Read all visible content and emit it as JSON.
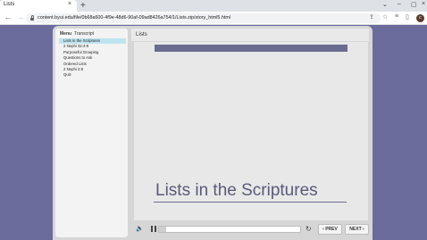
{
  "browser": {
    "tab_title": "Lists",
    "tab_close": "×",
    "new_tab": "+",
    "url": "content.byui.edu/file/0b68a600-4f9e-48d6-90af-09ad8426a754/1/Lists.zip/story_html5.html",
    "window_controls": {
      "menu": "⌄",
      "minimize": "–",
      "maximize": "▢",
      "close": "×"
    },
    "nav": {
      "back": "←",
      "forward": "→",
      "reload": "↻"
    },
    "profile_initial": "c"
  },
  "player": {
    "sidebar": {
      "tabs": [
        {
          "label": "Menu",
          "active": true
        },
        {
          "label": "Transcript",
          "active": false
        }
      ],
      "items": [
        {
          "label": "Lists in the Scriptures",
          "selected": true
        },
        {
          "label": "2 Nephi 32:4-9",
          "selected": false
        },
        {
          "label": "Purposeful Grouping",
          "selected": false
        },
        {
          "label": "Questions to Ask",
          "selected": false
        },
        {
          "label": "Ordered Lists",
          "selected": false
        },
        {
          "label": "2 Nephi 2:8",
          "selected": false
        },
        {
          "label": "Quiz",
          "selected": false
        }
      ]
    },
    "header_title": "Lists",
    "slide_title": "Lists in the Scriptures",
    "controls": {
      "progress": 0.05,
      "prev_label": "PREV",
      "next_label": "NEXT"
    }
  },
  "colors": {
    "background": "#6b6b9c",
    "slide_accent": "#6a6b91",
    "selected_item": "#bfe4f0"
  }
}
